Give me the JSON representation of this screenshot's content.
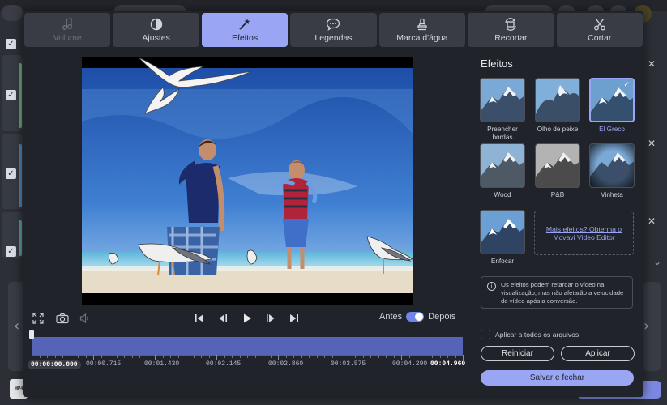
{
  "tabs": [
    {
      "label": "Volume",
      "icon": "music-note-icon",
      "state": "disabled"
    },
    {
      "label": "Ajustes",
      "icon": "contrast-icon",
      "state": "normal"
    },
    {
      "label": "Efeitos",
      "icon": "magic-wand-icon",
      "state": "active"
    },
    {
      "label": "Legendas",
      "icon": "speech-bubble-icon",
      "state": "normal"
    },
    {
      "label": "Marca d'água",
      "icon": "stamp-icon",
      "state": "normal"
    },
    {
      "label": "Recortar",
      "icon": "crop-rotate-icon",
      "state": "normal"
    },
    {
      "label": "Cortar",
      "icon": "scissors-icon",
      "state": "normal"
    }
  ],
  "player": {
    "compare_before": "Antes",
    "compare_after": "Depois",
    "compare_enabled": true
  },
  "timeline": {
    "current_time": "00:00:00.000",
    "labels": [
      "00:00.715",
      "00:01.430",
      "00:02.145",
      "00:02.860",
      "00:03.575",
      "00:04.290"
    ],
    "end_time": "00:04.960"
  },
  "effects_panel": {
    "title": "Efeitos",
    "effects": [
      {
        "name": "Preencher bordas",
        "selected": false
      },
      {
        "name": "Olho de peixe",
        "selected": false
      },
      {
        "name": "El Greco",
        "selected": true
      },
      {
        "name": "Wood",
        "selected": false
      },
      {
        "name": "P&B",
        "selected": false
      },
      {
        "name": "Vinheta",
        "selected": false
      },
      {
        "name": "Enfocar",
        "selected": false
      }
    ],
    "more_effects_link": "Mais efeitos? Obtenha o Movavi Video Editor",
    "info_text": "Os efeitos podem retardar o vídeo na visualização, mas não afetarão a velocidade do vídeo após a conversão.",
    "apply_all_label": "Aplicar a todos os arquivos",
    "apply_all_checked": false,
    "reset_label": "Reiniciar",
    "apply_label": "Aplicar",
    "save_close_label": "Salvar e fechar"
  },
  "background_app": {
    "logo_text": "MP4"
  },
  "colors": {
    "accent": "#9aa6f3",
    "timeline_fill": "#5664b8",
    "modal_bg": "#20232a",
    "tab_bg": "#393c44"
  }
}
